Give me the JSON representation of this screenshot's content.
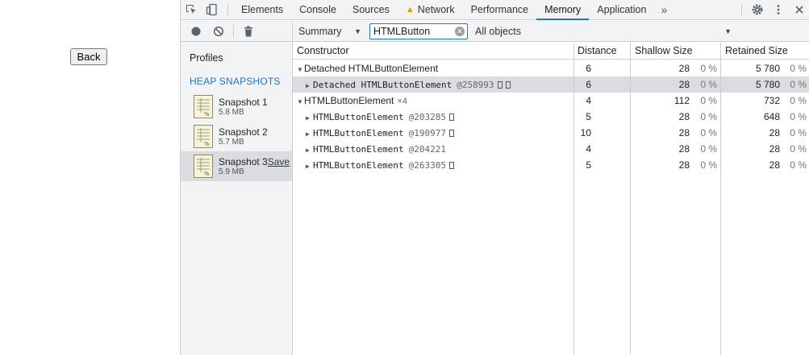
{
  "page": {
    "back_button": "Back"
  },
  "tabbar": {
    "tabs": [
      {
        "label": "Elements"
      },
      {
        "label": "Console"
      },
      {
        "label": "Sources"
      },
      {
        "label": "Network"
      },
      {
        "label": "Performance"
      },
      {
        "label": "Memory"
      },
      {
        "label": "Application"
      }
    ],
    "more": "»"
  },
  "sidebar": {
    "profiles_title": "Profiles",
    "heap_title": "HEAP SNAPSHOTS",
    "snapshots": [
      {
        "name": "Snapshot 1",
        "size": "5.8 MB"
      },
      {
        "name": "Snapshot 2",
        "size": "5.7 MB"
      },
      {
        "name": "Snapshot 3",
        "size": "5.9 MB",
        "save": "Save"
      }
    ]
  },
  "toolbar": {
    "view": "Summary",
    "filter_value": "HTMLButton",
    "objects": "All objects"
  },
  "grid": {
    "headers": {
      "constructor": "Constructor",
      "distance": "Distance",
      "shallow": "Shallow Size",
      "retained": "Retained Size"
    },
    "rows": [
      {
        "name": "Detached HTMLButtonElement",
        "id": "",
        "count": "",
        "distance": "6",
        "shallow": "28",
        "shallow_pct": "0 %",
        "retained": "5 780",
        "retained_pct": "0 %"
      },
      {
        "name": "Detached HTMLButtonElement",
        "id": "@258993",
        "count": "",
        "distance": "6",
        "shallow": "28",
        "shallow_pct": "0 %",
        "retained": "5 780",
        "retained_pct": "0 %"
      },
      {
        "name": "HTMLButtonElement",
        "id": "",
        "count": "×4",
        "distance": "4",
        "shallow": "112",
        "shallow_pct": "0 %",
        "retained": "732",
        "retained_pct": "0 %"
      },
      {
        "name": "HTMLButtonElement",
        "id": "@203285",
        "count": "",
        "distance": "5",
        "shallow": "28",
        "shallow_pct": "0 %",
        "retained": "648",
        "retained_pct": "0 %"
      },
      {
        "name": "HTMLButtonElement",
        "id": "@190977",
        "count": "",
        "distance": "10",
        "shallow": "28",
        "shallow_pct": "0 %",
        "retained": "28",
        "retained_pct": "0 %"
      },
      {
        "name": "HTMLButtonElement",
        "id": "@204221",
        "count": "",
        "distance": "4",
        "shallow": "28",
        "shallow_pct": "0 %",
        "retained": "28",
        "retained_pct": "0 %"
      },
      {
        "name": "HTMLButtonElement",
        "id": "@263305",
        "count": "",
        "distance": "5",
        "shallow": "28",
        "shallow_pct": "0 %",
        "retained": "28",
        "retained_pct": "0 %"
      }
    ]
  },
  "colors": {
    "accent": "#1a73e8",
    "selected_row": "#dadce0",
    "warning": "#f29900"
  }
}
